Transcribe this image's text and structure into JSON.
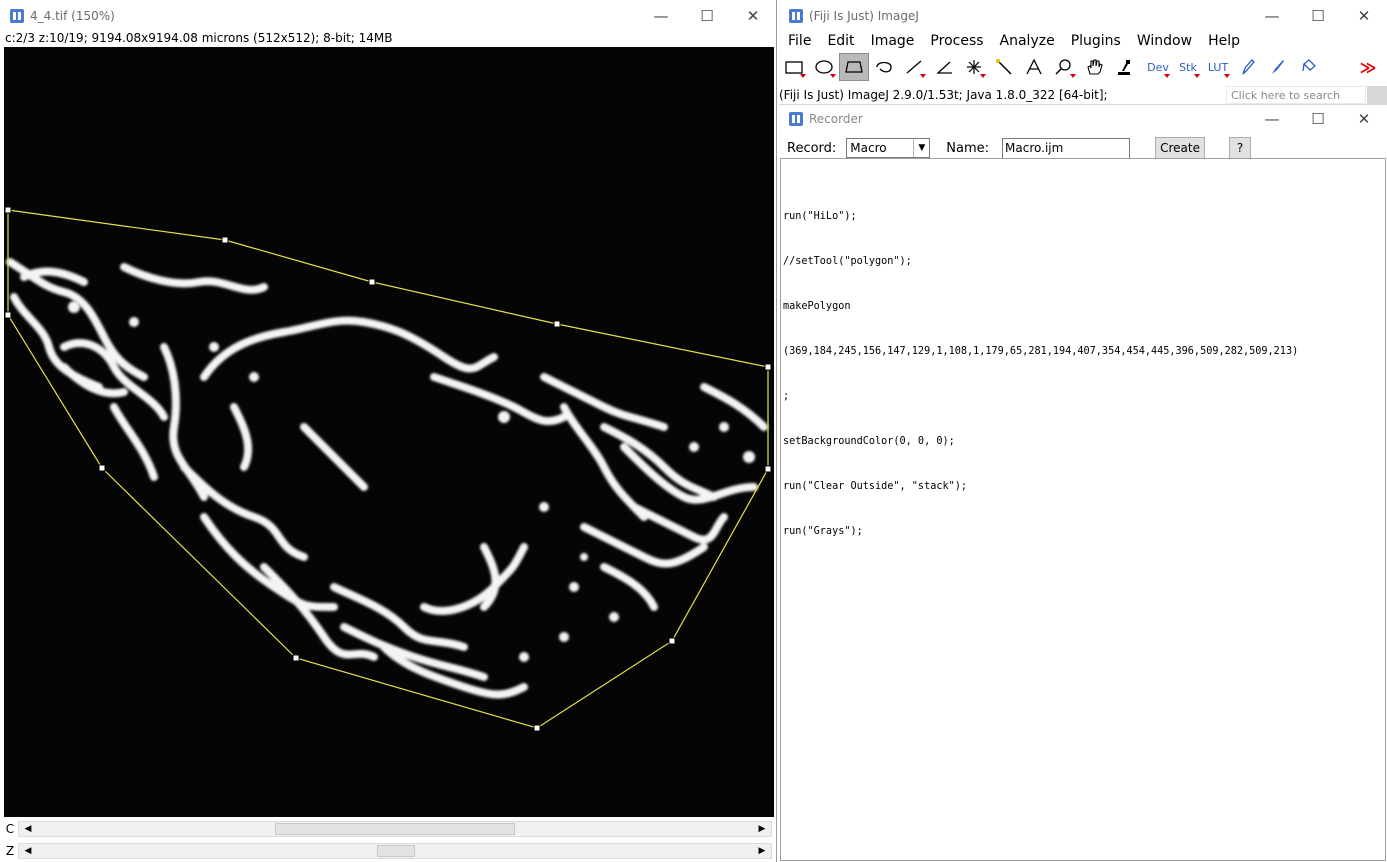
{
  "image_window": {
    "title": "4_4.tif (150%)",
    "info": "c:2/3 z:10/19; 9194.08x9194.08 microns (512x512); 8-bit; 14MB",
    "scroll_c_label": "C",
    "scroll_z_label": "Z",
    "c_position": "2/3",
    "z_position": "10/19",
    "roi_color": "#e6e04a"
  },
  "imagej_window": {
    "title": "(Fiji Is Just) ImageJ",
    "menu": [
      "File",
      "Edit",
      "Image",
      "Process",
      "Analyze",
      "Plugins",
      "Window",
      "Help"
    ],
    "tools": [
      {
        "name": "rectangle-tool-icon"
      },
      {
        "name": "oval-tool-icon"
      },
      {
        "name": "polygon-tool-icon",
        "selected": true
      },
      {
        "name": "freehand-tool-icon"
      },
      {
        "name": "line-tool-icon"
      },
      {
        "name": "angle-tool-icon"
      },
      {
        "name": "point-tool-icon"
      },
      {
        "name": "wand-tool-icon"
      },
      {
        "name": "text-tool-icon"
      },
      {
        "name": "magnifier-tool-icon"
      },
      {
        "name": "hand-tool-icon"
      },
      {
        "name": "dropper-tool-icon"
      }
    ],
    "dev_label": "Dev",
    "stk_label": "Stk",
    "lut_label": "LUT",
    "status": "(Fiji Is Just) ImageJ 2.9.0/1.53t; Java 1.8.0_322 [64-bit];",
    "search_placeholder": "Click here to search"
  },
  "recorder": {
    "title": "Recorder",
    "record_label": "Record:",
    "record_value": "Macro",
    "name_label": "Name:",
    "name_value": "Macro.ijm",
    "create_label": "Create",
    "help_label": "?",
    "code_lines": [
      "run(\"HiLo\");",
      "//setTool(\"polygon\");",
      "makePolygon",
      "(369,184,245,156,147,129,1,108,1,179,65,281,194,407,354,454,445,396,509,282,509,213)",
      ";",
      "setBackgroundColor(0, 0, 0);",
      "run(\"Clear Outside\", \"stack\");",
      "run(\"Grays\");"
    ]
  },
  "window_controls": {
    "minimize": "—",
    "maximize": "☐",
    "close": "✕"
  }
}
